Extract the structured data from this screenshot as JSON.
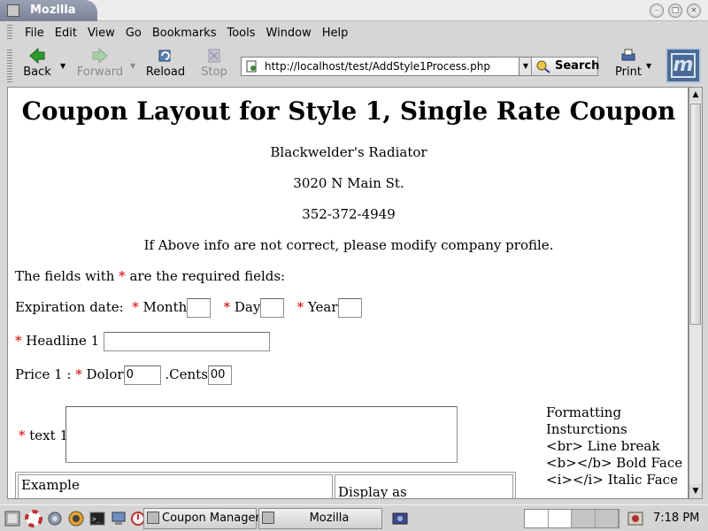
{
  "window": {
    "title": "Mozilla"
  },
  "menu": [
    "File",
    "Edit",
    "View",
    "Go",
    "Bookmarks",
    "Tools",
    "Window",
    "Help"
  ],
  "toolbar": {
    "back": "Back",
    "forward": "Forward",
    "reload": "Reload",
    "stop": "Stop",
    "url": "http://localhost/test/AddStyle1Process.php",
    "search": "Search",
    "print": "Print"
  },
  "page": {
    "title": "Coupon Layout for Style 1, Single Rate Coupon",
    "company": "Blackwelder's Radiator",
    "address": "3020 N Main St.",
    "phone": "352-372-4949",
    "notice": "If Above info are not correct, please modify company profile.",
    "required_note_a": "The fields with",
    "required_note_b": "are the required fields:",
    "asterisk": "*",
    "expiration_label": "Expiration date:",
    "month_label": "Month",
    "day_label": "Day",
    "year_label": "Year",
    "headline_label": "Headline 1",
    "price_label": "Price 1 :",
    "dolor_label": "Dolor",
    "dolor_value": "0",
    "cents_label": ".Cents",
    "cents_value": "00",
    "text_label": "text 1",
    "formatting": {
      "title": "Formatting Insturctions",
      "lines": [
        "<br> Line break",
        "<b></b> Bold Face",
        "<i></i> Italic Face"
      ]
    },
    "example_header": "Example",
    "display_header": "Display as"
  },
  "taskbar": {
    "tasks": [
      "Coupon Manager",
      "Mozilla"
    ],
    "clock": "7:18 PM"
  }
}
